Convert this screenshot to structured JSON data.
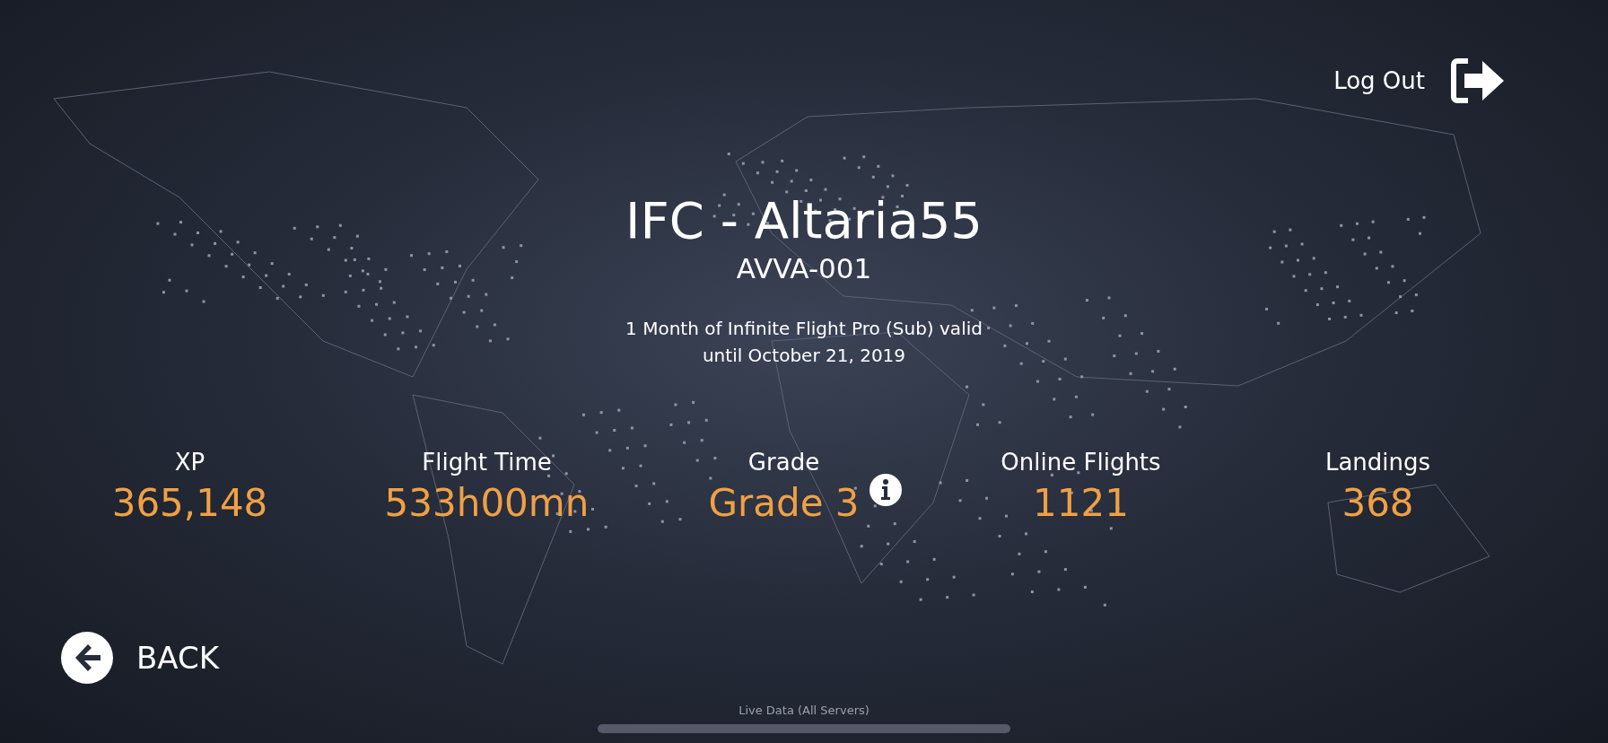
{
  "logout": {
    "label": "Log Out"
  },
  "profile": {
    "name": "IFC - Altaria55",
    "code": "AVVA-001",
    "subscription": [
      "1 Month of Infinite Flight Pro (Sub) valid",
      "until October 21, 2019"
    ]
  },
  "stats": [
    {
      "kind": "plain",
      "label": "XP",
      "value": "365,148"
    },
    {
      "kind": "plain",
      "label": "Flight Time",
      "value": "533h00mn"
    },
    {
      "kind": "info",
      "label": "Grade",
      "value": "Grade 3"
    },
    {
      "kind": "plain",
      "label": "Online Flights",
      "value": "1121"
    },
    {
      "kind": "plain",
      "label": "Landings",
      "value": "368"
    }
  ],
  "back": {
    "label": "BACK"
  },
  "footer": {
    "label": "Live Data (All Servers)"
  }
}
